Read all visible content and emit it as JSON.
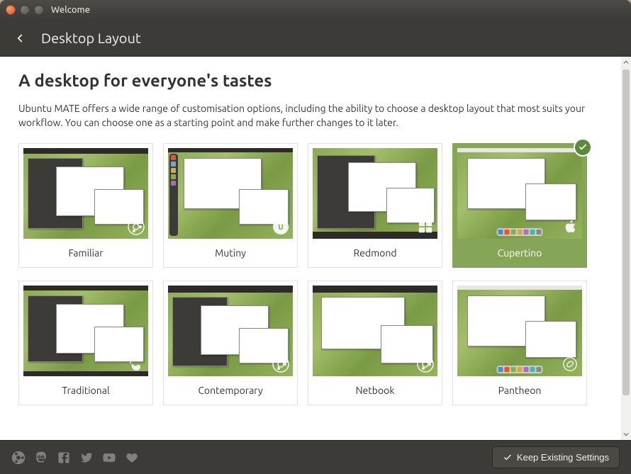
{
  "window": {
    "title": "Welcome"
  },
  "header": {
    "title": "Desktop Layout"
  },
  "page": {
    "heading": "A desktop for everyone's tastes",
    "description": "Ubuntu MATE offers a wide range of customisation options, including the ability to choose a desktop layout that most suits your workflow. You can choose one as a starting point and make further changes to it later."
  },
  "layouts": [
    {
      "name": "Familiar",
      "selected": false
    },
    {
      "name": "Mutiny",
      "selected": false
    },
    {
      "name": "Redmond",
      "selected": false
    },
    {
      "name": "Cupertino",
      "selected": true
    },
    {
      "name": "Traditional",
      "selected": false
    },
    {
      "name": "Contemporary",
      "selected": false
    },
    {
      "name": "Netbook",
      "selected": false
    },
    {
      "name": "Pantheon",
      "selected": false
    }
  ],
  "footer": {
    "keep_button": "Keep Existing Settings"
  }
}
